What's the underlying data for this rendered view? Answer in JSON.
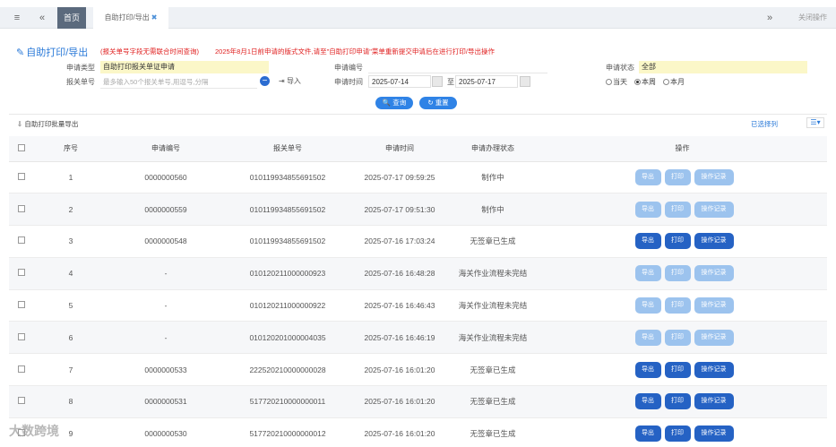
{
  "tabs": {
    "home": "首页",
    "print_tab": "自助打印/导出",
    "close_ops": "关闭操作"
  },
  "page": {
    "title": "自助打印/导出",
    "notice1": "(报关单号字段无需联合时间查询)",
    "notice2": "2025年8月1日前申请的版式文件,请至\"自助打印申请\"菜单重新提交申请后在进行打印/导出操作"
  },
  "filters": {
    "apply_type_label": "申请类型",
    "apply_type_value": "自助打印报关单证申请",
    "decl_no_label": "报关单号",
    "decl_no_placeholder": "最多输入50个报关单号,用逗号,分隔",
    "import_label": "导入",
    "apply_no_label": "申请编号",
    "apply_time_label": "申请时间",
    "date_from": "2025-07-14",
    "date_to_sep": "至",
    "date_to": "2025-07-17",
    "status_label": "申请状态",
    "status_value": "全部",
    "radio_today": "当天",
    "radio_week": "本周",
    "radio_month": "本月"
  },
  "buttons": {
    "query": "查询",
    "reset": "重置",
    "batch_export": "自助打印批量导出",
    "selected_cols": "已选择列"
  },
  "table": {
    "headers": [
      "序号",
      "申请编号",
      "报关单号",
      "申请时间",
      "申请办理状态",
      "操作"
    ],
    "op_labels": [
      "导出",
      "打印",
      "操作记录"
    ],
    "rows": [
      {
        "no": "1",
        "apply": "0000000560",
        "decl": "010119934855691502",
        "time": "2025-07-17 09:59:25",
        "status": "制作中"
      },
      {
        "no": "2",
        "apply": "0000000559",
        "decl": "010119934855691502",
        "time": "2025-07-17 09:51:30",
        "status": "制作中"
      },
      {
        "no": "3",
        "apply": "0000000548",
        "decl": "010119934855691502",
        "time": "2025-07-16 17:03:24",
        "status": "无签章已生成"
      },
      {
        "no": "4",
        "apply": "-",
        "decl": "010120211000000923",
        "time": "2025-07-16 16:48:28",
        "status": "海关作业流程未完结"
      },
      {
        "no": "5",
        "apply": "-",
        "decl": "010120211000000922",
        "time": "2025-07-16 16:46:43",
        "status": "海关作业流程未完结"
      },
      {
        "no": "6",
        "apply": "-",
        "decl": "010120201000004035",
        "time": "2025-07-16 16:46:19",
        "status": "海关作业流程未完结"
      },
      {
        "no": "7",
        "apply": "0000000533",
        "decl": "222520210000000028",
        "time": "2025-07-16 16:01:20",
        "status": "无签章已生成"
      },
      {
        "no": "8",
        "apply": "0000000531",
        "decl": "517720210000000011",
        "time": "2025-07-16 16:01:20",
        "status": "无签章已生成"
      },
      {
        "no": "9",
        "apply": "0000000530",
        "decl": "517720210000000012",
        "time": "2025-07-16 16:01:20",
        "status": "无签章已生成"
      }
    ]
  },
  "watermark": "大数跨境"
}
